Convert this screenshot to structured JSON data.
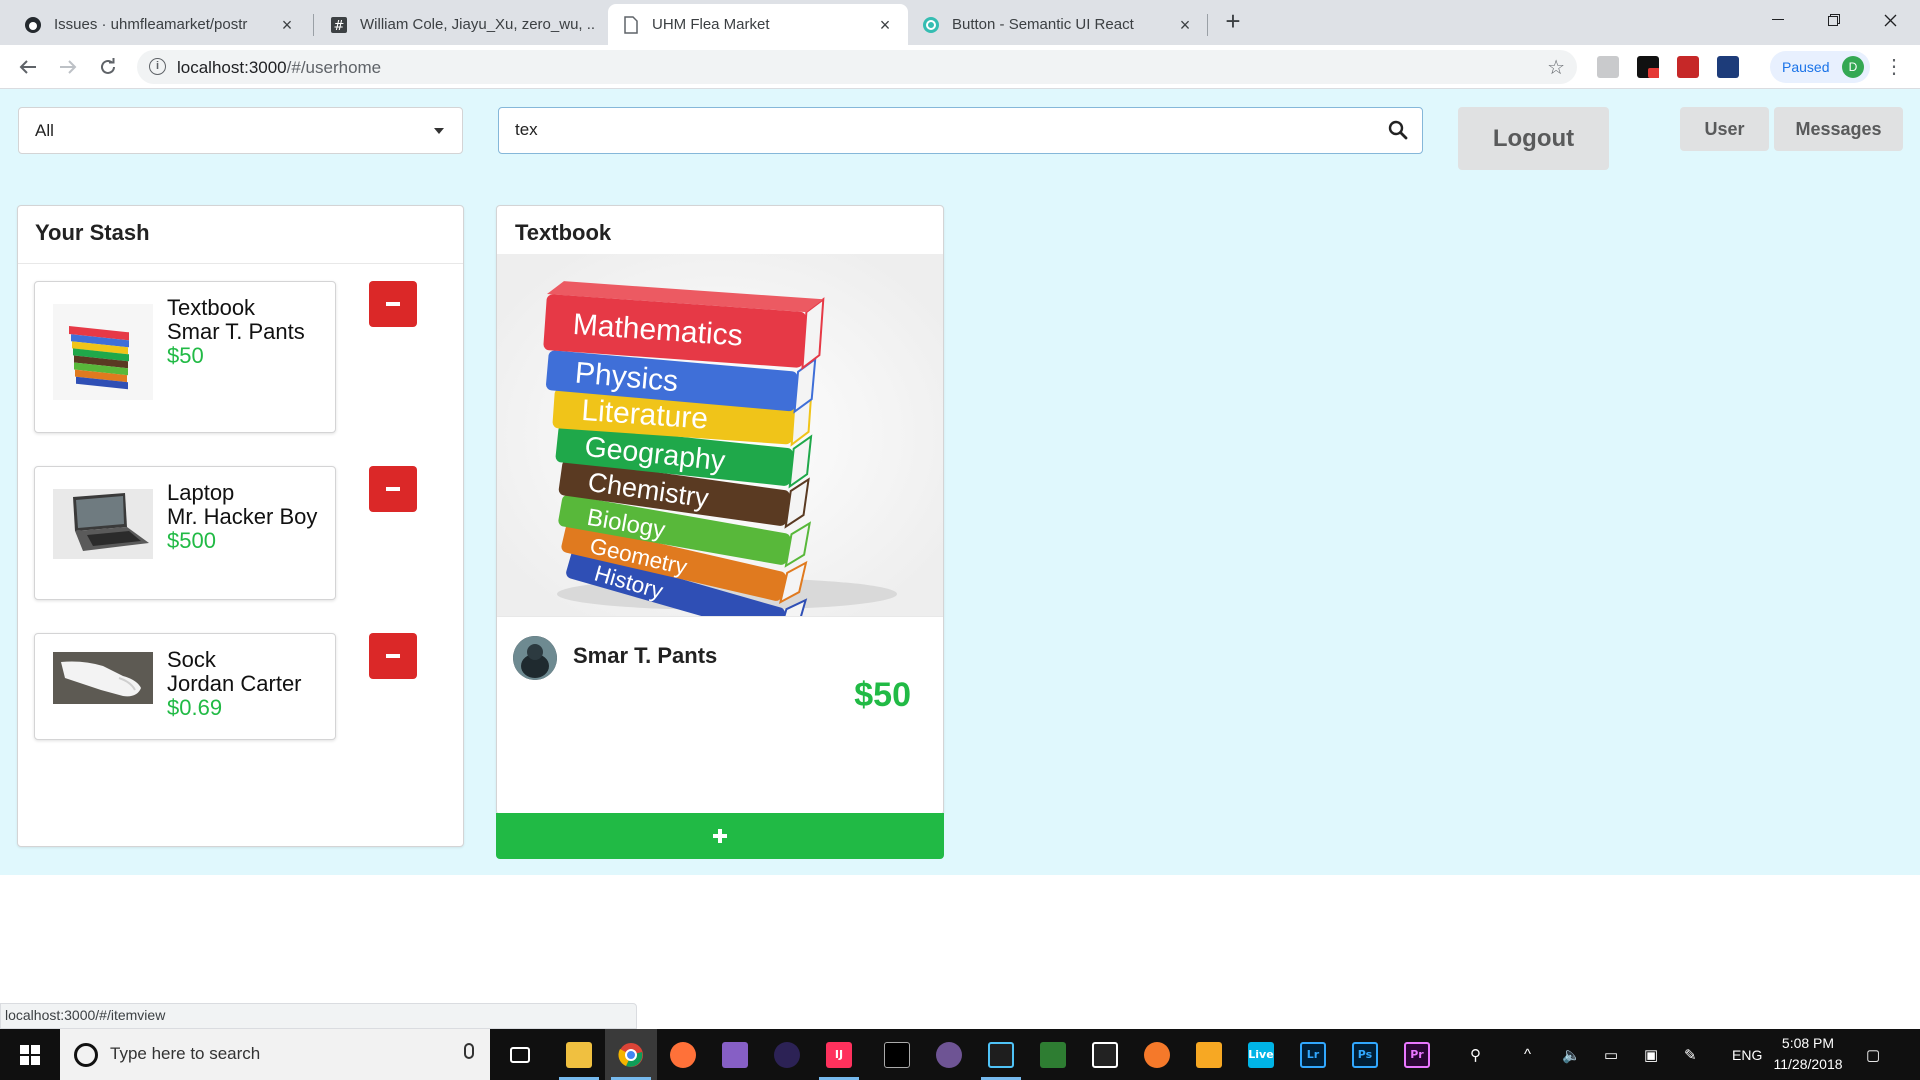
{
  "browser": {
    "tabs": [
      {
        "title": "Issues · uhmfleamarket/postr",
        "icon": "github-icon",
        "active": false
      },
      {
        "title": "William Cole, Jiayu_Xu, zero_wu, ...",
        "icon": "slack-icon",
        "active": false
      },
      {
        "title": "UHM Flea Market",
        "icon": "page-icon",
        "active": true
      },
      {
        "title": "Button - Semantic UI React",
        "icon": "semantic-ui-icon",
        "active": false
      }
    ],
    "url_host": "localhost:3000",
    "url_path": "/#/userhome",
    "profile_status": "Paused",
    "profile_initial": "D"
  },
  "filter": {
    "selected": "All"
  },
  "search": {
    "value": "tex"
  },
  "buttons": {
    "logout": "Logout",
    "user": "User",
    "messages": "Messages"
  },
  "stash": {
    "title": "Your Stash",
    "items": [
      {
        "name": "Textbook",
        "seller": "Smar T. Pants",
        "price": "$50"
      },
      {
        "name": "Laptop",
        "seller": "Mr. Hacker Boy",
        "price": "$500"
      },
      {
        "name": "Sock",
        "seller": "Jordan Carter",
        "price": "$0.69"
      }
    ]
  },
  "item_card": {
    "title": "Textbook",
    "seller": "Smar T. Pants",
    "price": "$50",
    "book_spines": [
      "Mathematics",
      "Physics",
      "Literature",
      "Geography",
      "Chemistry",
      "Biology",
      "Geometry",
      "History"
    ],
    "book_colors": [
      "#e63946",
      "#3f6fd8",
      "#f0c419",
      "#1fa84a",
      "#5a3a22",
      "#58b83a",
      "#e07a1f",
      "#2f4fb5"
    ]
  },
  "status_url": "localhost:3000/#/itemview",
  "taskbar": {
    "search_placeholder": "Type here to search",
    "lang": "ENG",
    "time": "5:08 PM",
    "date": "11/28/2018"
  },
  "colors": {
    "page_bg": "#e0f8fd",
    "green": "#21ba45",
    "red": "#db2828"
  }
}
